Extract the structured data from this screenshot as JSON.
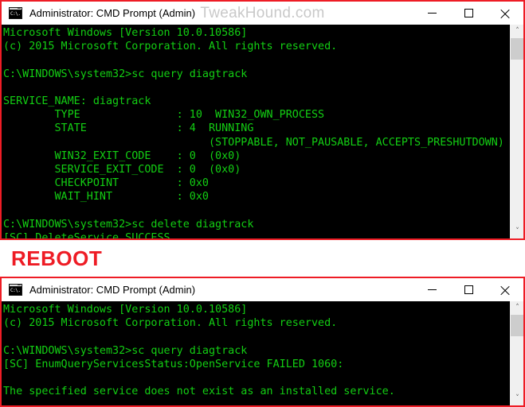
{
  "window_one": {
    "title": "Administrator: CMD Prompt (Admin)",
    "icon_text": "C:\\.",
    "watermark": "TweakHound.com",
    "controls": {
      "minimize": "minimize",
      "maximize": "maximize",
      "close": "close"
    },
    "scrollbar": {
      "up_arrow": "˄",
      "down_arrow": "˅"
    },
    "console_text": "Microsoft Windows [Version 10.0.10586]\n(c) 2015 Microsoft Corporation. All rights reserved.\n\nC:\\WINDOWS\\system32>sc query diagtrack\n\nSERVICE_NAME: diagtrack\n        TYPE               : 10  WIN32_OWN_PROCESS\n        STATE              : 4  RUNNING\n                                (STOPPABLE, NOT_PAUSABLE, ACCEPTS_PRESHUTDOWN)\n        WIN32_EXIT_CODE    : 0  (0x0)\n        SERVICE_EXIT_CODE  : 0  (0x0)\n        CHECKPOINT         : 0x0\n        WAIT_HINT          : 0x0\n\nC:\\WINDOWS\\system32>sc delete diagtrack\n[SC] DeleteService SUCCESS"
  },
  "reboot_label": "REBOOT",
  "window_two": {
    "title": "Administrator: CMD Prompt (Admin)",
    "icon_text": "C:\\.",
    "controls": {
      "minimize": "minimize",
      "maximize": "maximize",
      "close": "close"
    },
    "scrollbar": {
      "up_arrow": "˄",
      "down_arrow": "˅"
    },
    "console_text": "Microsoft Windows [Version 10.0.10586]\n(c) 2015 Microsoft Corporation. All rights reserved.\n\nC:\\WINDOWS\\system32>sc query diagtrack\n[SC] EnumQueryServicesStatus:OpenService FAILED 1060:\n\nThe specified service does not exist as an installed service."
  },
  "colors": {
    "window_border": "#ee1c25",
    "console_background": "#000000",
    "console_text": "#13cf13",
    "reboot_red": "#ee1c25",
    "watermark_gray": "#c9c9c9"
  }
}
